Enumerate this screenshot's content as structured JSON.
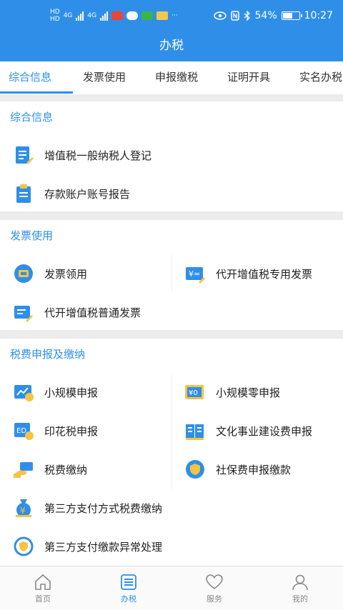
{
  "status_bar": {
    "net_top": "HD",
    "net_bottom": "HD",
    "signal_1_label": "4G",
    "signal_2_label": "4G",
    "more": "···",
    "battery": "54%",
    "time": "10:27"
  },
  "header": {
    "title": "办税"
  },
  "tabs": [
    {
      "label": "综合信息",
      "active": true
    },
    {
      "label": "发票使用"
    },
    {
      "label": "申报缴税"
    },
    {
      "label": "证明开具"
    },
    {
      "label": "实名办税"
    }
  ],
  "sections": [
    {
      "title": "综合信息",
      "items": [
        {
          "label": "增值税一般纳税人登记",
          "icon": "form-edit-icon"
        },
        {
          "label": "存款账户账号报告",
          "icon": "clipboard-icon"
        }
      ]
    },
    {
      "title": "发票使用",
      "items": [
        {
          "label": "发票领用",
          "icon": "invoice-ticket-icon"
        },
        {
          "label": "代开增值税专用发票",
          "icon": "yen-invoice-icon"
        },
        {
          "label": "代开增值税普通发票",
          "icon": "invoice-edit-icon"
        }
      ]
    },
    {
      "title": "税费申报及缴纳",
      "items": [
        {
          "label": "小规模申报",
          "icon": "chart-declare-icon"
        },
        {
          "label": "小规模零申报",
          "icon": "zero-declare-icon"
        },
        {
          "label": "印花税申报",
          "icon": "stamp-tax-icon"
        },
        {
          "label": "文化事业建设费申报",
          "icon": "book-icon"
        },
        {
          "label": "税费缴纳",
          "icon": "money-hand-icon"
        },
        {
          "label": "社保费申报缴款",
          "icon": "shield-icon"
        },
        {
          "label": "第三方支付方式税费缴纳",
          "icon": "money-bag-icon"
        },
        {
          "label": "第三方支付缴款异常处理",
          "icon": "shield-refresh-icon"
        }
      ]
    }
  ],
  "bottom_nav": [
    {
      "label": "首页",
      "icon": "home-icon"
    },
    {
      "label": "办税",
      "icon": "list-icon",
      "active": true
    },
    {
      "label": "服务",
      "icon": "heart-icon"
    },
    {
      "label": "我的",
      "icon": "user-icon"
    }
  ],
  "colors": {
    "primary": "#2f8fe8",
    "icon_yellow": "#f6c343",
    "background": "#ececec"
  }
}
